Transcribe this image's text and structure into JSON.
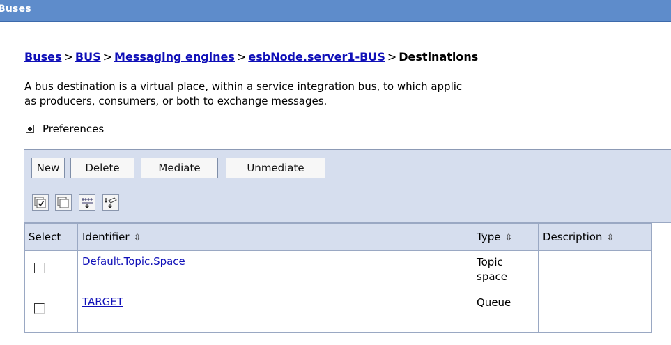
{
  "window": {
    "title": "Buses"
  },
  "breadcrumb": {
    "items": [
      "Buses",
      "BUS",
      "Messaging engines",
      "esbNode.server1-BUS"
    ],
    "separator": ">",
    "current": "Destinations"
  },
  "description": {
    "line1": "A bus destination is a virtual place, within a service integration bus, to which applic",
    "line2": "as producers, consumers, or both to exchange messages."
  },
  "preferences": {
    "label": "Preferences"
  },
  "toolbar": {
    "new_label": "New",
    "delete_label": "Delete",
    "mediate_label": "Mediate",
    "unmediate_label": "Unmediate"
  },
  "icon_toolbar": {
    "icons": [
      "select-all-icon",
      "deselect-all-icon",
      "show-filter-icon",
      "clear-filter-icon"
    ]
  },
  "table": {
    "headers": {
      "select": "Select",
      "identifier": "Identifier",
      "type": "Type",
      "description": "Description"
    },
    "rows": [
      {
        "identifier": "Default.Topic.Space",
        "type_line1": "Topic",
        "type_line2": "space",
        "description": ""
      },
      {
        "identifier": "TARGET",
        "type_line1": "Queue",
        "type_line2": "",
        "description": ""
      }
    ]
  },
  "colors": {
    "titlebar": "#5e8ccb",
    "link": "#1010b8",
    "toolbar_bg": "#d6deee"
  }
}
